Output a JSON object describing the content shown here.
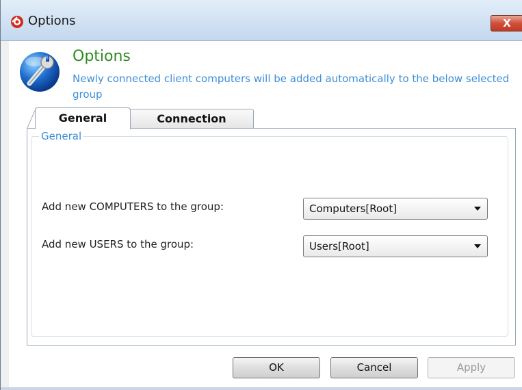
{
  "window": {
    "title": "Options",
    "close_label": "X"
  },
  "header": {
    "title": "Options",
    "description": "Newly connected client computers will be added automatically to the below selected group"
  },
  "tabs": [
    {
      "label": "General",
      "active": true
    },
    {
      "label": "Connection",
      "active": false
    }
  ],
  "general": {
    "group_legend": "General",
    "computers_label": "Add new COMPUTERS to the group:",
    "computers_value": "Computers[Root]",
    "users_label": "Add new USERS to the group:",
    "users_value": "Users[Root]"
  },
  "buttons": {
    "ok": "OK",
    "cancel": "Cancel",
    "apply": "Apply",
    "apply_enabled": false
  },
  "icons": {
    "app": "app-logo-icon",
    "header": "options-wrench-globe-icon",
    "dropdown": "chevron-down-icon",
    "close": "close-icon"
  },
  "colors": {
    "header_title": "#2e8b20",
    "description": "#3c8fd6",
    "close_button": "#c23a22"
  }
}
